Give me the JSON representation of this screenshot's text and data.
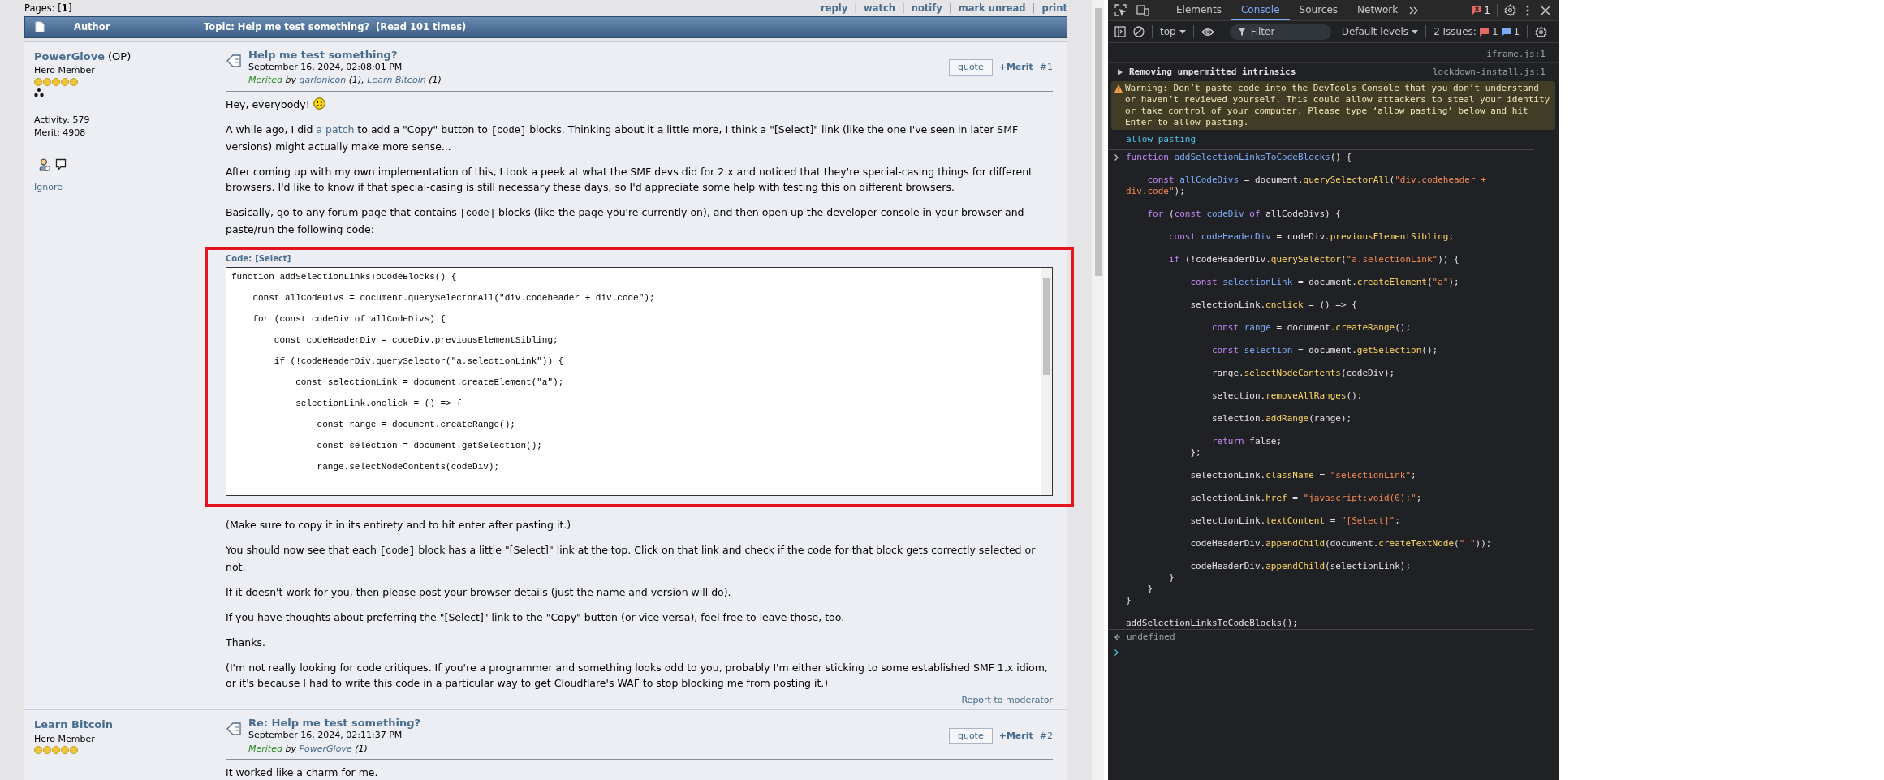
{
  "forum": {
    "pages": "Pages: [**1**]",
    "separator": "|",
    "actions": [
      "reply",
      "watch",
      "notify",
      "mark unread",
      "print"
    ],
    "header": {
      "author": "Author",
      "topic": "Topic: Help me test something?  (Read 101 times)"
    },
    "posts": [
      {
        "author": "PowerGlove",
        "op": "(OP)",
        "rank": "Hero Member",
        "stars": 5,
        "activity": "Activity: 579",
        "merit_total": "Merit: 4908",
        "ignore": "Ignore",
        "title": "Help me test something?",
        "date": "September 16, 2024, 02:08:01 PM",
        "merited_label": "Merited",
        "merited_by": "by",
        "meriters": [
          {
            "name": "garlonicon",
            "count": "(1)"
          },
          {
            "name": "Learn Bitcoin",
            "count": "(1)"
          }
        ],
        "meriters_separator": ",",
        "quote": "quote",
        "merit": "+Merit",
        "number": "#1",
        "body": [
          {
            "kind": "paragraph",
            "segments": [
              {
                "kind": "text",
                "text": "Hey, everybody! "
              },
              {
                "kind": "smiley"
              }
            ]
          },
          {
            "kind": "paragraph",
            "segments": [
              {
                "kind": "text",
                "text": "A while ago, I did "
              },
              {
                "kind": "link",
                "text": "a patch"
              },
              {
                "kind": "text",
                "text": " to add a \"Copy\" button to "
              },
              {
                "kind": "code",
                "text": "[code]"
              },
              {
                "kind": "text",
                "text": " blocks. Thinking about it a little more, I think a \"[Select]\" link (like the one I've seen in later SMF versions) might actually make more sense..."
              }
            ]
          },
          {
            "kind": "paragraph",
            "segments": [
              {
                "kind": "text",
                "text": "After coming up with my own implementation of this, I took a peek at what the SMF devs did for 2.x and noticed that they're special-casing things for different browsers. I'd like to know if that special-casing is still necessary these days, so I'd appreciate some help with testing this on different browsers."
              }
            ]
          },
          {
            "kind": "paragraph",
            "segments": [
              {
                "kind": "text",
                "text": "Basically, go to any forum page that contains "
              },
              {
                "kind": "code",
                "text": "[code]"
              },
              {
                "kind": "text",
                "text": " blocks (like the page you're currently on), and then open up the developer console in your browser and paste/run the following code:"
              }
            ]
          },
          {
            "kind": "codeblock",
            "label": "Code:",
            "select": "[Select]",
            "highlighted": true,
            "lines": [
              "function addSelectionLinksToCodeBlocks() {",
              "    const allCodeDivs = document.querySelectorAll(\"div.codeheader + div.code\");",
              "    for (const codeDiv of allCodeDivs) {",
              "        const codeHeaderDiv = codeDiv.previousElementSibling;",
              "        if (!codeHeaderDiv.querySelector(\"a.selectionLink\")) {",
              "            const selectionLink = document.createElement(\"a\");",
              "            selectionLink.onclick = () => {",
              "                const range = document.createRange();",
              "                const selection = document.getSelection();",
              "                range.selectNodeContents(codeDiv);"
            ]
          },
          {
            "kind": "paragraph",
            "segments": [
              {
                "kind": "text",
                "text": "(Make sure to copy it in its entirety and to hit enter after pasting it.)"
              }
            ]
          },
          {
            "kind": "paragraph",
            "segments": [
              {
                "kind": "text",
                "text": "You should now see that each "
              },
              {
                "kind": "code",
                "text": "[code]"
              },
              {
                "kind": "text",
                "text": " block has a little \"[Select]\" link at the top. Click on that link and check if the code for that block gets correctly selected or not."
              }
            ]
          },
          {
            "kind": "paragraph",
            "segments": [
              {
                "kind": "text",
                "text": "If it doesn't work for you, then please post your browser details (just the name and version will do)."
              }
            ]
          },
          {
            "kind": "paragraph",
            "segments": [
              {
                "kind": "text",
                "text": "If you have thoughts about preferring the \"[Select]\" link to the \"Copy\" button (or vice versa), feel free to leave those, too."
              }
            ]
          },
          {
            "kind": "paragraph",
            "segments": [
              {
                "kind": "text",
                "text": "Thanks."
              }
            ]
          },
          {
            "kind": "paragraph",
            "segments": [
              {
                "kind": "text",
                "text": "(I'm not really looking for code critiques. If you're a programmer and something looks odd to you, probably I'm either sticking to some established SMF 1.x idiom, or it's because I had to write this code in a particular way to get Cloudflare's WAF to stop blocking me from posting it.)"
              }
            ]
          }
        ],
        "report": "Report to moderator"
      },
      {
        "author": "Learn Bitcoin",
        "rank": "Hero Member",
        "stars": 5,
        "title": "Re: Help me test something?",
        "date": "September 16, 2024, 02:11:37 PM",
        "merited_label": "Merited",
        "merited_by": "by",
        "meriters": [
          {
            "name": "PowerGlove",
            "count": "(1)"
          }
        ],
        "quote": "quote",
        "merit": "+Merit",
        "number": "#2",
        "body": [
          {
            "kind": "paragraph",
            "segments": [
              {
                "kind": "text",
                "text": "It worked like a charm for me."
              }
            ]
          }
        ]
      }
    ]
  },
  "devtools": {
    "tabs": [
      {
        "label": "Elements",
        "selected": false
      },
      {
        "label": "Console",
        "selected": true
      },
      {
        "label": "Sources",
        "selected": false
      },
      {
        "label": "Network",
        "selected": false
      }
    ],
    "error_count": "1",
    "toolbar": {
      "context": "top",
      "filter_placeholder": "Filter",
      "levels": "Default levels",
      "issues_label": "2 Issues:",
      "issue_errors": "1",
      "issue_info": "1"
    },
    "messages": [
      {
        "kind": "source",
        "source": "iframe.js:1"
      },
      {
        "kind": "group",
        "text": "Removing unpermitted intrinsics",
        "source": "lockdown-install.js:1",
        "expanded": false
      },
      {
        "kind": "warning",
        "text": "Warning: Don’t paste code into the DevTools Console that you don’t understand or haven’t reviewed yourself. This could allow attackers to steal your identity or take control of your computer. Please type ‘allow pasting’ below and hit Enter to allow pasting."
      },
      {
        "kind": "info",
        "text": "allow pasting"
      }
    ],
    "input": [
      {
        "lines": [
          [
            {
              "kind": "keyword",
              "text": "function "
            },
            {
              "kind": "def",
              "text": "addSelectionLinksToCodeBlocks"
            },
            {
              "kind": "plain",
              "text": "() {"
            }
          ]
        ]
      },
      {
        "lines": [
          [
            {
              "kind": "keyword",
              "text": "    const "
            },
            {
              "kind": "def",
              "text": "allCodeDivs"
            },
            {
              "kind": "plain",
              "text": " = document."
            },
            {
              "kind": "prop",
              "text": "querySelectorAll"
            },
            {
              "kind": "plain",
              "text": "("
            },
            {
              "kind": "string",
              "text": "\"div.codeheader + div.code\""
            },
            {
              "kind": "plain",
              "text": ");"
            }
          ]
        ]
      },
      {
        "lines": [
          [
            {
              "kind": "keyword",
              "text": "    for "
            },
            {
              "kind": "plain",
              "text": "("
            },
            {
              "kind": "keyword",
              "text": "const "
            },
            {
              "kind": "def",
              "text": "codeDiv "
            },
            {
              "kind": "keyword",
              "text": "of "
            },
            {
              "kind": "plain",
              "text": "allCodeDivs) {"
            }
          ]
        ]
      },
      {
        "lines": [
          [
            {
              "kind": "keyword",
              "text": "        const "
            },
            {
              "kind": "def",
              "text": "codeHeaderDiv"
            },
            {
              "kind": "plain",
              "text": " = codeDiv."
            },
            {
              "kind": "prop",
              "text": "previousElementSibling"
            },
            {
              "kind": "plain",
              "text": ";"
            }
          ]
        ]
      },
      {
        "lines": [
          [
            {
              "kind": "keyword",
              "text": "        if "
            },
            {
              "kind": "plain",
              "text": "(!codeHeaderDiv."
            },
            {
              "kind": "prop",
              "text": "querySelector"
            },
            {
              "kind": "plain",
              "text": "("
            },
            {
              "kind": "string",
              "text": "\"a.selectionLink\""
            },
            {
              "kind": "plain",
              "text": ")) {"
            }
          ]
        ]
      },
      {
        "lines": [
          [
            {
              "kind": "keyword",
              "text": "            const "
            },
            {
              "kind": "def",
              "text": "selectionLink"
            },
            {
              "kind": "plain",
              "text": " = document."
            },
            {
              "kind": "prop",
              "text": "createElement"
            },
            {
              "kind": "plain",
              "text": "("
            },
            {
              "kind": "string",
              "text": "\"a\""
            },
            {
              "kind": "plain",
              "text": ");"
            }
          ]
        ]
      },
      {
        "lines": [
          [
            {
              "kind": "plain",
              "text": "            selectionLink."
            },
            {
              "kind": "prop",
              "text": "onclick"
            },
            {
              "kind": "plain",
              "text": " = () => {"
            }
          ]
        ]
      },
      {
        "lines": [
          [
            {
              "kind": "keyword",
              "text": "                const "
            },
            {
              "kind": "def",
              "text": "range"
            },
            {
              "kind": "plain",
              "text": " = document."
            },
            {
              "kind": "prop",
              "text": "createRange"
            },
            {
              "kind": "plain",
              "text": "();"
            }
          ]
        ]
      },
      {
        "lines": [
          [
            {
              "kind": "keyword",
              "text": "                const "
            },
            {
              "kind": "def",
              "text": "selection"
            },
            {
              "kind": "plain",
              "text": " = document."
            },
            {
              "kind": "prop",
              "text": "getSelection"
            },
            {
              "kind": "plain",
              "text": "();"
            }
          ]
        ]
      },
      {
        "lines": [
          [
            {
              "kind": "plain",
              "text": "                range."
            },
            {
              "kind": "prop",
              "text": "selectNodeContents"
            },
            {
              "kind": "plain",
              "text": "(codeDiv);"
            }
          ]
        ]
      },
      {
        "lines": [
          [
            {
              "kind": "plain",
              "text": "                selection."
            },
            {
              "kind": "prop",
              "text": "removeAllRanges"
            },
            {
              "kind": "plain",
              "text": "();"
            }
          ]
        ]
      },
      {
        "lines": [
          [
            {
              "kind": "plain",
              "text": "                selection."
            },
            {
              "kind": "prop",
              "text": "addRange"
            },
            {
              "kind": "plain",
              "text": "(range);"
            }
          ]
        ]
      },
      {
        "lines": [
          [
            {
              "kind": "keyword",
              "text": "                return "
            },
            {
              "kind": "plain",
              "text": "false;"
            }
          ],
          [
            {
              "kind": "plain",
              "text": "            };"
            }
          ]
        ]
      },
      {
        "lines": [
          [
            {
              "kind": "plain",
              "text": "            selectionLink."
            },
            {
              "kind": "prop",
              "text": "className"
            },
            {
              "kind": "plain",
              "text": " = "
            },
            {
              "kind": "string",
              "text": "\"selectionLink\""
            },
            {
              "kind": "plain",
              "text": ";"
            }
          ]
        ]
      },
      {
        "lines": [
          [
            {
              "kind": "plain",
              "text": "            selectionLink."
            },
            {
              "kind": "prop",
              "text": "href"
            },
            {
              "kind": "plain",
              "text": " = "
            },
            {
              "kind": "string",
              "text": "\"javascript:void(0);\""
            },
            {
              "kind": "plain",
              "text": ";"
            }
          ]
        ]
      },
      {
        "lines": [
          [
            {
              "kind": "plain",
              "text": "            selectionLink."
            },
            {
              "kind": "prop",
              "text": "textContent"
            },
            {
              "kind": "plain",
              "text": " = "
            },
            {
              "kind": "string",
              "text": "\"[Select]\""
            },
            {
              "kind": "plain",
              "text": ";"
            }
          ]
        ]
      },
      {
        "lines": [
          [
            {
              "kind": "plain",
              "text": "            codeHeaderDiv."
            },
            {
              "kind": "prop",
              "text": "appendChild"
            },
            {
              "kind": "plain",
              "text": "(document."
            },
            {
              "kind": "prop",
              "text": "createTextNode"
            },
            {
              "kind": "plain",
              "text": "("
            },
            {
              "kind": "string",
              "text": "\" \""
            },
            {
              "kind": "plain",
              "text": "));"
            }
          ]
        ]
      },
      {
        "lines": [
          [
            {
              "kind": "plain",
              "text": "            codeHeaderDiv."
            },
            {
              "kind": "prop",
              "text": "appendChild"
            },
            {
              "kind": "plain",
              "text": "(selectionLink);"
            }
          ],
          [
            {
              "kind": "plain",
              "text": "        }"
            }
          ],
          [
            {
              "kind": "plain",
              "text": "    }"
            }
          ],
          [
            {
              "kind": "plain",
              "text": "}"
            }
          ]
        ]
      },
      {
        "lines": [
          [
            {
              "kind": "plain",
              "text": "addSelectionLinksToCodeBlocks();"
            }
          ]
        ]
      }
    ],
    "result": "undefined"
  }
}
